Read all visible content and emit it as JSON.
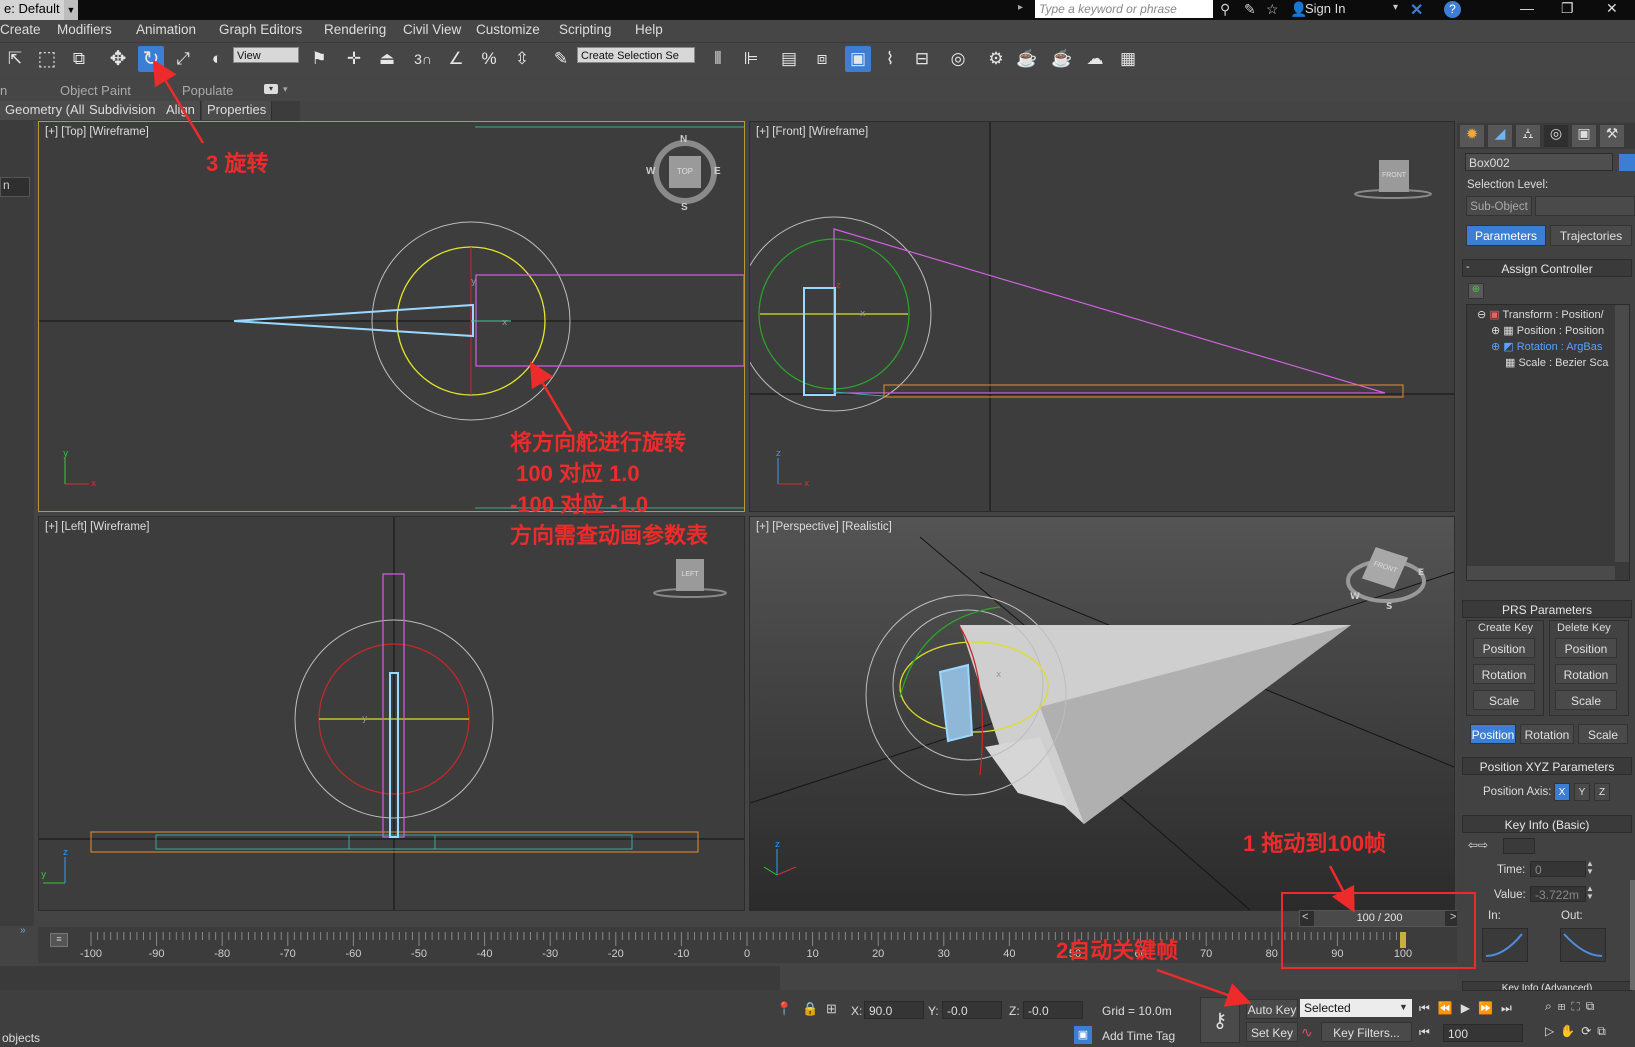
{
  "title_bar": {
    "workspace": "e: Default",
    "search_placeholder": "Type a keyword or phrase",
    "sign_in": "Sign In",
    "help_glyph": "?"
  },
  "menu": [
    "Create",
    "Modifiers",
    "Animation",
    "Graph Editors",
    "Rendering",
    "Civil View",
    "Customize",
    "Scripting",
    "Help"
  ],
  "toolbar": {
    "ref_coord": "View",
    "selection_set_placeholder": "Create Selection Se",
    "snap_3": "3",
    "active_tool": "rotate"
  },
  "ribbon": {
    "left_frag": "n",
    "object_paint": "Object Paint",
    "populate": "Populate",
    "subtabs": [
      "Geometry (All)",
      "Subdivision",
      "Align",
      "Properties"
    ]
  },
  "left_strip": {
    "frag": "n"
  },
  "viewports": {
    "top": {
      "label": "[+] [Top] [Wireframe]",
      "cube": "TOP",
      "compass": [
        "N",
        "E",
        "S",
        "W"
      ]
    },
    "front": {
      "label": "[+] [Front] [Wireframe]",
      "cube": "FRONT"
    },
    "left": {
      "label": "[+] [Left] [Wireframe]",
      "cube": "LEFT"
    },
    "perspective": {
      "label": "[+] [Perspective] [Realistic]",
      "cube": "FRONT"
    }
  },
  "timeline": {
    "frame_display": "100 / 200",
    "prev": "<",
    "next": ">",
    "ticks": [
      "-100",
      "-90",
      "-80",
      "-70",
      "-60",
      "-50",
      "-40",
      "-30",
      "-20",
      "-10",
      "0",
      "10",
      "20",
      "30",
      "40",
      "50",
      "60",
      "70",
      "80",
      "90",
      "100"
    ]
  },
  "status": {
    "left_text": "objects",
    "x_label": "X:",
    "x_value": "90.0",
    "y_label": "Y:",
    "y_value": "-0.0",
    "z_label": "Z:",
    "z_value": "-0.0",
    "grid": "Grid = 10.0m",
    "add_time_tag": "Add Time Tag",
    "auto_key": "Auto Key",
    "set_key": "Set Key",
    "selected": "Selected",
    "key_filters": "Key Filters...",
    "frame_field": "100"
  },
  "command_panel": {
    "object_name": "Box002",
    "selection_level": "Selection Level:",
    "sub_object": "Sub-Object",
    "tab_parameters": "Parameters",
    "tab_trajectories": "Trajectories",
    "assign_controller": "Assign Controller",
    "tree": [
      "Transform : Position/",
      "Position : Position",
      "Rotation : ArgBas",
      "Scale : Bezier Sca"
    ],
    "prs_title": "PRS Parameters",
    "create_key": "Create Key",
    "delete_key": "Delete Key",
    "create_buttons": [
      "Position",
      "Rotation",
      "Scale"
    ],
    "delete_buttons": [
      "Position",
      "Rotation",
      "Scale"
    ],
    "mode_buttons": [
      "Position",
      "Rotation",
      "Scale"
    ],
    "pos_xyz_title": "Position XYZ Parameters",
    "position_axis": "Position Axis:",
    "axes": [
      "X",
      "Y",
      "Z"
    ],
    "key_info_title": "Key Info (Basic)",
    "time_label": "Time:",
    "time_value": "0",
    "value_label": "Value:",
    "value_value": "-3.722m",
    "in_label": "In:",
    "out_label": "Out:",
    "key_info_adv": "Key Info (Advanced)"
  },
  "annotations": {
    "step3": "3 旋转",
    "note_lines": [
      "将方向舵进行旋转",
      " 100 对应 1.0",
      "-100 对应 -1.0",
      "方向需查动画参数表"
    ],
    "step1": "1 拖动到100帧",
    "step2": "2自动关键帧"
  },
  "colors": {
    "accent": "#3b7ed3",
    "annotation": "#ee2b2b",
    "active_viewport_border": "#b89a36"
  }
}
